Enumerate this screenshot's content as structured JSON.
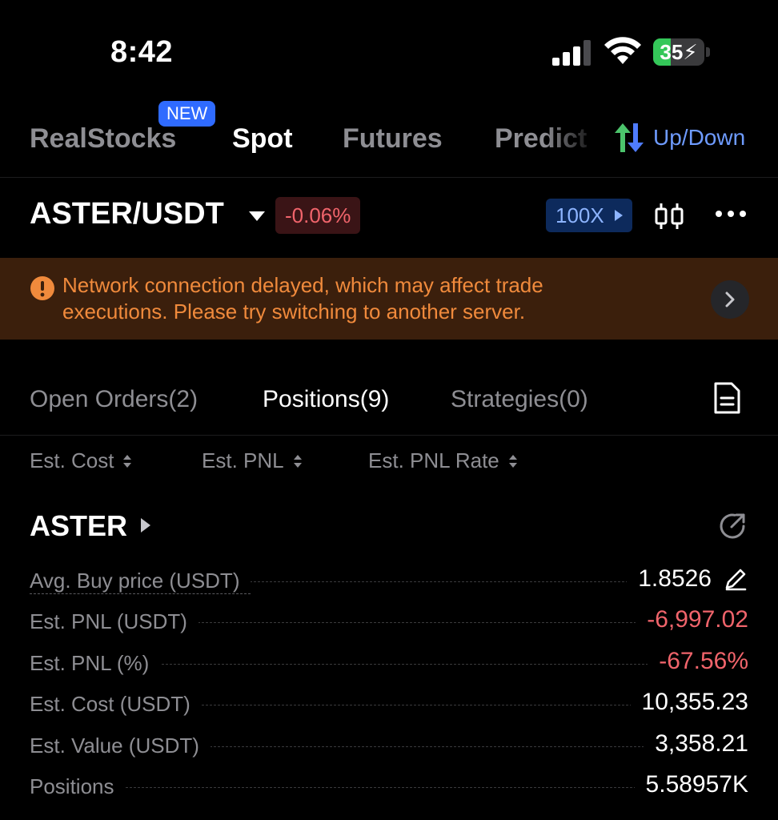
{
  "status_bar": {
    "time": "8:42",
    "battery_level": "35",
    "battery_fraction": 0.35,
    "icons": [
      "signal-icon",
      "wifi-icon",
      "battery-icon"
    ]
  },
  "category_tabs": {
    "items": [
      "RealStocks",
      "Spot",
      "Futures",
      "Predict"
    ],
    "active": "Spot",
    "new_badge": "NEW",
    "up_down_label": "Up/Down"
  },
  "pair": {
    "name": "ASTER/USDT",
    "change": "-0.06%",
    "leverage": "100X"
  },
  "warning": {
    "line1": "Network connection delayed, which may affect trade",
    "line2": "executions. Please try switching to another server."
  },
  "position_tabs": {
    "open_orders": "Open Orders(2)",
    "positions": "Positions(9)",
    "strategies": "Strategies(0)",
    "active": "Positions(9)"
  },
  "sort_options": [
    "Est. Cost",
    "Est. PNL",
    "Est. PNL Rate"
  ],
  "asset": {
    "symbol": "ASTER",
    "rows": [
      {
        "label": "Avg. Buy price (USDT)",
        "value": "1.8526"
      },
      {
        "label": "Est. PNL (USDT)",
        "value": "-6,997.02"
      },
      {
        "label": "Est. PNL (%)",
        "value": "-67.56%"
      },
      {
        "label": "Est. Cost (USDT)",
        "value": "10,355.23"
      },
      {
        "label": "Est. Value (USDT)",
        "value": "3,358.21"
      },
      {
        "label": "Positions",
        "value": "5.58957K"
      }
    ]
  },
  "colors": {
    "negative": "#f0646b",
    "accent_blue": "#2f6bff",
    "warning_text": "#f08a3c",
    "warning_bg": "#3b1f0c"
  }
}
